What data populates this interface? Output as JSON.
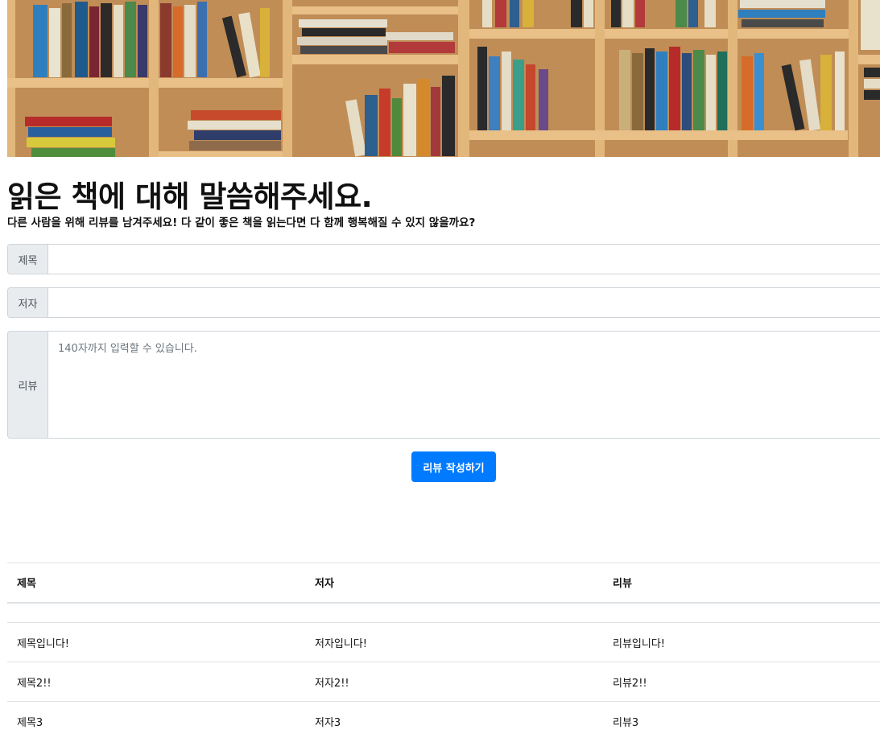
{
  "page": {
    "title": "읽은 책에 대해 말씀해주세요.",
    "subtitle": "다른 사람을 위해 리뷰를 남겨주세요! 다 같이 좋은 책을 읽는다면 다 함께 행복해질 수 있지 않을까요?"
  },
  "banner": {
    "description_icon": "bookshelf-image"
  },
  "form": {
    "title_label": "제목",
    "title_value": "",
    "author_label": "저자",
    "author_value": "",
    "review_label": "리뷰",
    "review_placeholder": "140자까지 입력할 수 있습니다.",
    "submit_label": "리뷰 작성하기"
  },
  "table": {
    "headers": [
      "제목",
      "저자",
      "리뷰"
    ],
    "rows": [
      [
        "제목입니다!",
        "저자입니다!",
        "리뷰입니다!"
      ],
      [
        "제목2!!",
        "저자2!!",
        "리뷰2!!"
      ],
      [
        "제목3",
        "저자3",
        "리뷰3"
      ]
    ]
  },
  "colors": {
    "primary": "#007bff",
    "addon_bg": "#e9ecef",
    "border": "#ced4da",
    "shelf_wood": "#c99a5d"
  }
}
